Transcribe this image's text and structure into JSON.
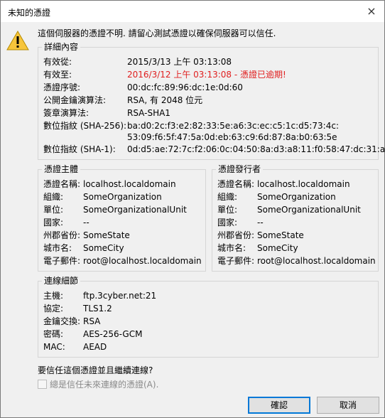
{
  "window": {
    "title": "未知的憑證",
    "close_icon": "×"
  },
  "warning_message": "這個伺服器的憑證不明. 請留心測試憑證以確保伺服器可以信任.",
  "details": {
    "title": "詳細內容",
    "rows": [
      {
        "label": "有效從:",
        "value": "2015/3/13 上午 03:13:08"
      },
      {
        "label": "有效至:",
        "value": "2016/3/12 上午 03:13:08 - 憑證已逾期!"
      },
      {
        "label": "憑證序號:",
        "value": "00:dc:fc:89:96:dc:1e:0d:60"
      },
      {
        "label": "公開金鑰演算法:",
        "value": "RSA, 有 2048 位元"
      },
      {
        "label": "簽章演算法:",
        "value": "RSA-SHA1"
      },
      {
        "label": "數位指紋 (SHA-256):",
        "value": "ba:d0:2c:f3:e2:82:33:5e:a6:3c:ec:c5:1c:d5:73:4c:",
        "value2": "53:09:f6:5f:47:5a:0d:eb:63:c9:6d:87:8a:b0:63:5e"
      },
      {
        "label": "數位指紋 (SHA-1):",
        "value": "0d:d5:ae:72:7c:f2:06:0c:04:50:8a:d3:a8:11:f0:58:47:dc:31:a7"
      }
    ]
  },
  "subject": {
    "title": "憑證主體",
    "rows": [
      {
        "label": "憑證名稱:",
        "value": "localhost.localdomain"
      },
      {
        "label": "組織:",
        "value": "SomeOrganization"
      },
      {
        "label": "單位:",
        "value": "SomeOrganizationalUnit"
      },
      {
        "label": "國家:",
        "value": "--"
      },
      {
        "label": "州郡省份:",
        "value": "SomeState"
      },
      {
        "label": "城市名:",
        "value": "SomeCity"
      },
      {
        "label": "電子郵件:",
        "value": "root@localhost.localdomain"
      }
    ]
  },
  "issuer": {
    "title": "憑證發行者",
    "rows": [
      {
        "label": "憑證名稱:",
        "value": "localhost.localdomain"
      },
      {
        "label": "組織:",
        "value": "SomeOrganization"
      },
      {
        "label": "單位:",
        "value": "SomeOrganizationalUnit"
      },
      {
        "label": "國家:",
        "value": "--"
      },
      {
        "label": "州郡省份:",
        "value": "SomeState"
      },
      {
        "label": "城市名:",
        "value": "SomeCity"
      },
      {
        "label": "電子郵件:",
        "value": "root@localhost.localdomain"
      }
    ]
  },
  "connection": {
    "title": "連線細節",
    "rows": [
      {
        "label": "主機:",
        "value": "ftp.3cyber.net:21"
      },
      {
        "label": "協定:",
        "value": "TLS1.2"
      },
      {
        "label": "金鑰交換:",
        "value": "RSA"
      },
      {
        "label": "密碼:",
        "value": "AES-256-GCM"
      },
      {
        "label": "MAC:",
        "value": "AEAD"
      }
    ]
  },
  "question": "要信任這個憑證並且繼續連線?",
  "always_trust_label": "總是信任未來連線的憑證(A).",
  "buttons": {
    "ok": "確認",
    "cancel": "取消"
  },
  "colors": {
    "expired": "#e02020",
    "accent": "#0078d7"
  }
}
